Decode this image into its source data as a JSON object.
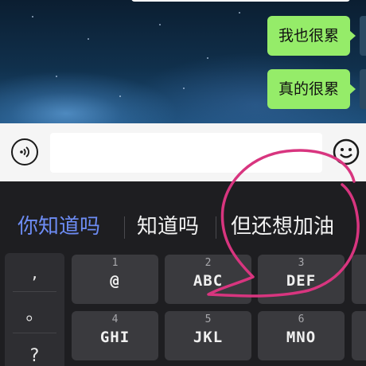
{
  "chat": {
    "messages": [
      {
        "text": "我也很累",
        "sender": "self"
      },
      {
        "text": "真的很累",
        "sender": "self"
      }
    ]
  },
  "input_bar": {
    "voice_icon": "voice-icon",
    "emoji_icon": "emoji-icon",
    "text_value": ""
  },
  "keyboard": {
    "candidates": [
      "你知道吗",
      "知道吗",
      "但还想加油"
    ],
    "side_keys": [
      ",",
      "。",
      "?"
    ],
    "keys": [
      {
        "num": "1",
        "letters": "@"
      },
      {
        "num": "2",
        "letters": "ABC"
      },
      {
        "num": "3",
        "letters": "DEF"
      },
      {
        "num": "4",
        "letters": "GHI"
      },
      {
        "num": "5",
        "letters": "JKL"
      },
      {
        "num": "6",
        "letters": "MNO"
      }
    ]
  },
  "colors": {
    "bubble": "#95ec69",
    "candidate_primary": "#6d8cf4",
    "keyboard_bg": "#1e1e21",
    "key_bg": "#3a3a3e",
    "annotation_stroke": "#d8357f"
  }
}
